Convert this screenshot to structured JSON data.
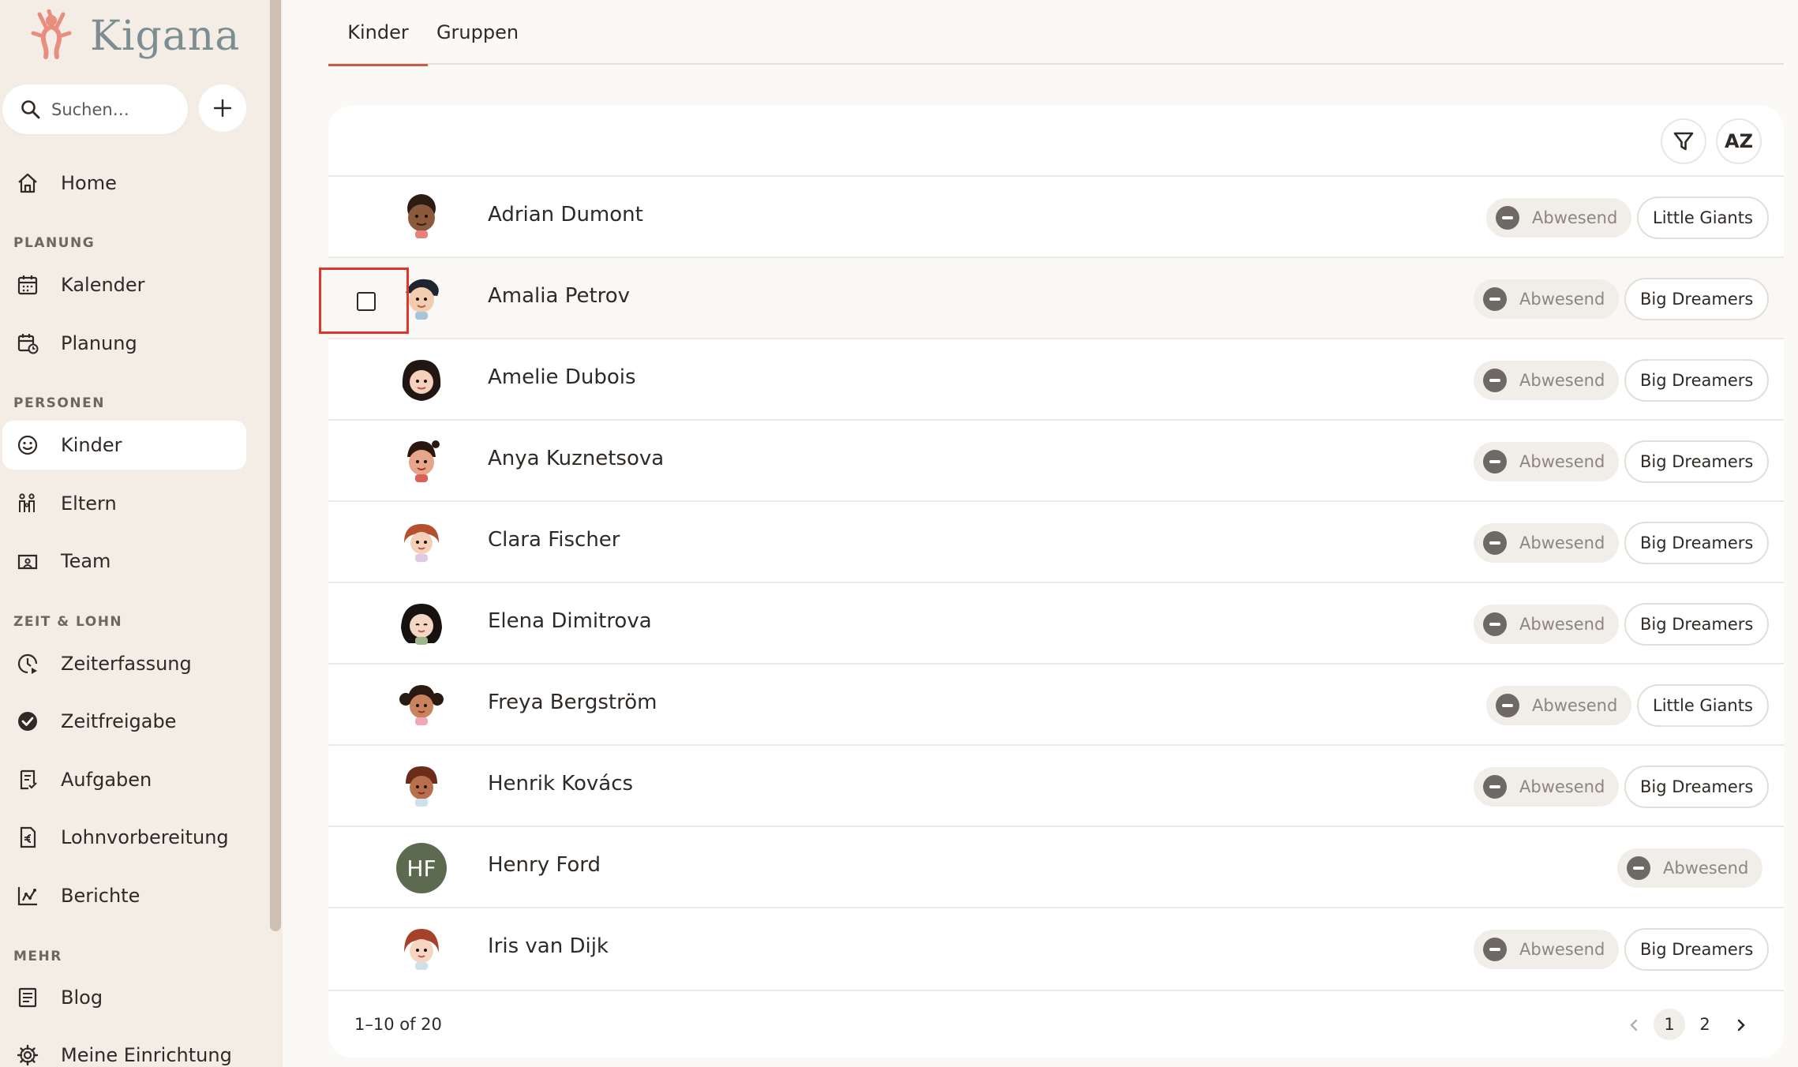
{
  "app": {
    "name": "Kigana"
  },
  "search": {
    "placeholder": "Suchen…"
  },
  "nav": {
    "home": "Home",
    "sections": {
      "planung": "PLANUNG",
      "personen": "PERSONEN",
      "zeit_lohn": "ZEIT & LOHN",
      "mehr": "MEHR"
    },
    "items": {
      "kalender": "Kalender",
      "planung": "Planung",
      "kinder": "Kinder",
      "eltern": "Eltern",
      "team": "Team",
      "zeiterfassung": "Zeiterfassung",
      "zeitfreigabe": "Zeitfreigabe",
      "aufgaben": "Aufgaben",
      "lohnvorbereitung": "Lohnvorbereitung",
      "berichte": "Berichte",
      "blog": "Blog",
      "meine_einrichtung": "Meine Einrichtung"
    }
  },
  "tabs": [
    "Kinder",
    "Gruppen"
  ],
  "toolbar": {
    "sort_label": "AZ"
  },
  "children": [
    {
      "name": "Adrian Dumont",
      "status": "Abwesend",
      "group": "Little Giants"
    },
    {
      "name": "Amalia Petrov",
      "status": "Abwesend",
      "group": "Big Dreamers"
    },
    {
      "name": "Amelie Dubois",
      "status": "Abwesend",
      "group": "Big Dreamers"
    },
    {
      "name": "Anya Kuznetsova",
      "status": "Abwesend",
      "group": "Big Dreamers"
    },
    {
      "name": "Clara Fischer",
      "status": "Abwesend",
      "group": "Big Dreamers"
    },
    {
      "name": "Elena Dimitrova",
      "status": "Abwesend",
      "group": "Big Dreamers"
    },
    {
      "name": "Freya Bergström",
      "status": "Abwesend",
      "group": "Little Giants"
    },
    {
      "name": "Henrik Kovács",
      "status": "Abwesend",
      "group": "Big Dreamers"
    },
    {
      "name": "Henry Ford",
      "status": "Abwesend",
      "group": "",
      "initials": "HF"
    },
    {
      "name": "Iris van Dijk",
      "status": "Abwesend",
      "group": "Big Dreamers"
    }
  ],
  "pagination": {
    "range": "1–10 of 20",
    "pages": [
      "1",
      "2"
    ],
    "current": "1"
  }
}
